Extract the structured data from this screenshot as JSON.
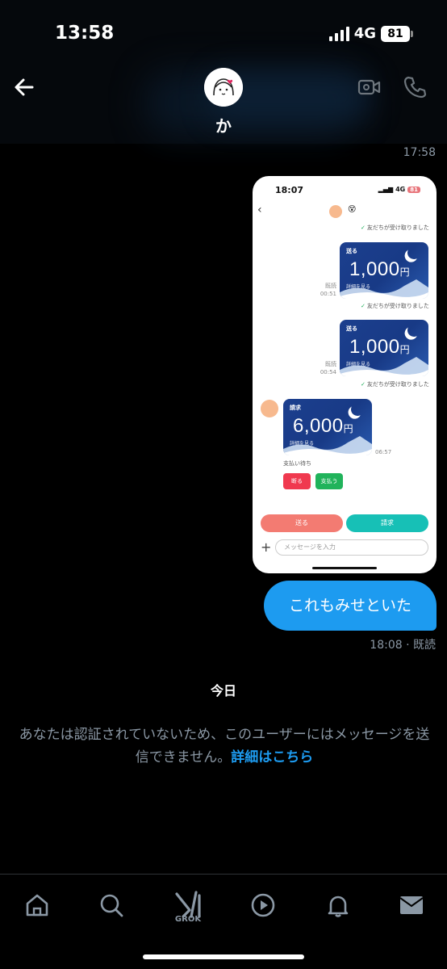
{
  "status_bar": {
    "time": "13:58",
    "network": "4G",
    "battery": "81"
  },
  "header": {
    "contact_name": "か"
  },
  "conversation": {
    "top_timestamp": "17:58",
    "embedded_screenshot": {
      "time": "18:07",
      "network": "4G",
      "battery": "81",
      "emoji": "😵",
      "notes": [
        "友だちが受け取りました",
        "友だちが受け取りました",
        "友だちが受け取りました"
      ],
      "cards": [
        {
          "label": "送る",
          "amount": "1,000",
          "currency": "円",
          "detail": "詳細を見る",
          "read": "既読",
          "time": "00:51"
        },
        {
          "label": "送る",
          "amount": "1,000",
          "currency": "円",
          "detail": "詳細を見る",
          "read": "既読",
          "time": "00:54"
        },
        {
          "label": "請求",
          "amount": "6,000",
          "currency": "円",
          "detail": "詳細を見る",
          "time": "06:57"
        }
      ],
      "pending_text": "支払い待ち",
      "decline_label": "断る",
      "pay_label": "支払う",
      "send_label": "送る",
      "request_label": "請求",
      "input_placeholder": "メッセージを入力"
    },
    "my_message": "これもみせといた",
    "my_message_meta": "18:08 · 既読",
    "day_divider": "今日",
    "notice_text": "あなたは認証されていないため、このユーザーにはメッセージを送信できません。",
    "notice_link": "詳細はこちら"
  },
  "nav": {
    "grok_label": "GROK",
    "items": [
      "home-icon",
      "search-icon",
      "grok-icon",
      "video-icon",
      "notifications-icon",
      "messages-icon"
    ]
  },
  "colors": {
    "accent": "#1d9bf0",
    "muted": "#8b98a5",
    "background": "#000000",
    "card_blue": "#1c3f8e"
  }
}
